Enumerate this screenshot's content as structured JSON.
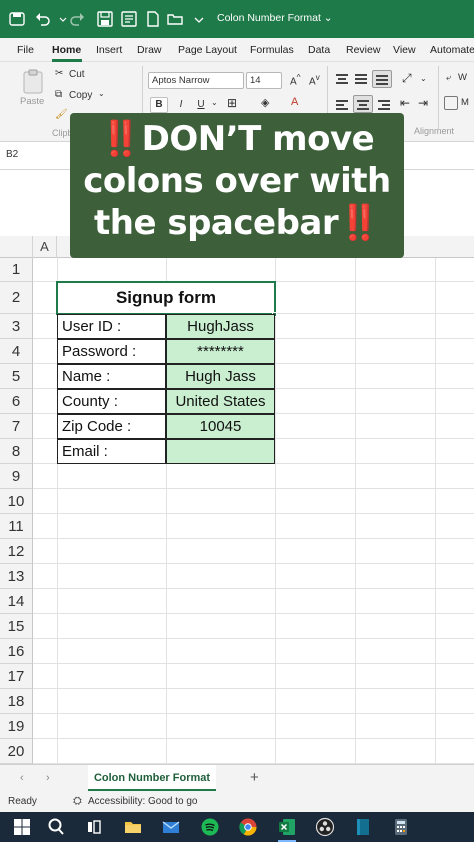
{
  "titlebar": {
    "document_title": "Colon Number Format ⌄"
  },
  "menu": {
    "tabs": [
      "File",
      "Home",
      "Insert",
      "Draw",
      "Page Layout",
      "Formulas",
      "Data",
      "Review",
      "View",
      "Automate"
    ],
    "active": "Home"
  },
  "ribbon": {
    "paste": "Paste",
    "cut": "Cut",
    "copy": "Copy",
    "clipboard_group": "Clipb",
    "font_name": "Aptos Narrow",
    "font_size": "14",
    "bold": "B",
    "italic": "I",
    "underline": "U",
    "alignment_group": "Alignment",
    "wrap": "W",
    "merge": "M"
  },
  "formula_bar": {
    "name_box": "B2"
  },
  "overlay": {
    "line1": "DON’T move",
    "line2": "colons over with",
    "line3": "the spacebar",
    "bang": "‼️"
  },
  "grid": {
    "columns": [
      "A"
    ],
    "rows": [
      "1",
      "2",
      "3",
      "4",
      "5",
      "6",
      "7",
      "8",
      "9",
      "10",
      "11",
      "12",
      "13",
      "14",
      "15",
      "16",
      "17",
      "18",
      "19",
      "20"
    ],
    "form_title": "Signup form",
    "form_rows": [
      {
        "label": "User ID :",
        "value": "HughJass"
      },
      {
        "label": "Password :",
        "value": "********"
      },
      {
        "label": "Name :",
        "value": "Hugh Jass"
      },
      {
        "label": "County :",
        "value": "United States"
      },
      {
        "label": "Zip Code :",
        "value": "10045"
      },
      {
        "label": "Email :",
        "value": ""
      }
    ]
  },
  "sheets": {
    "active_tab": "Colon Number Format",
    "add": "+"
  },
  "status": {
    "ready": "Ready",
    "accessibility": "Accessibility: Good to go"
  },
  "colors": {
    "excel_green": "#1f7a4a",
    "overlay_bg": "#3d5f3a",
    "value_fill": "#c9efd0",
    "bang_red": "#e8242a"
  }
}
